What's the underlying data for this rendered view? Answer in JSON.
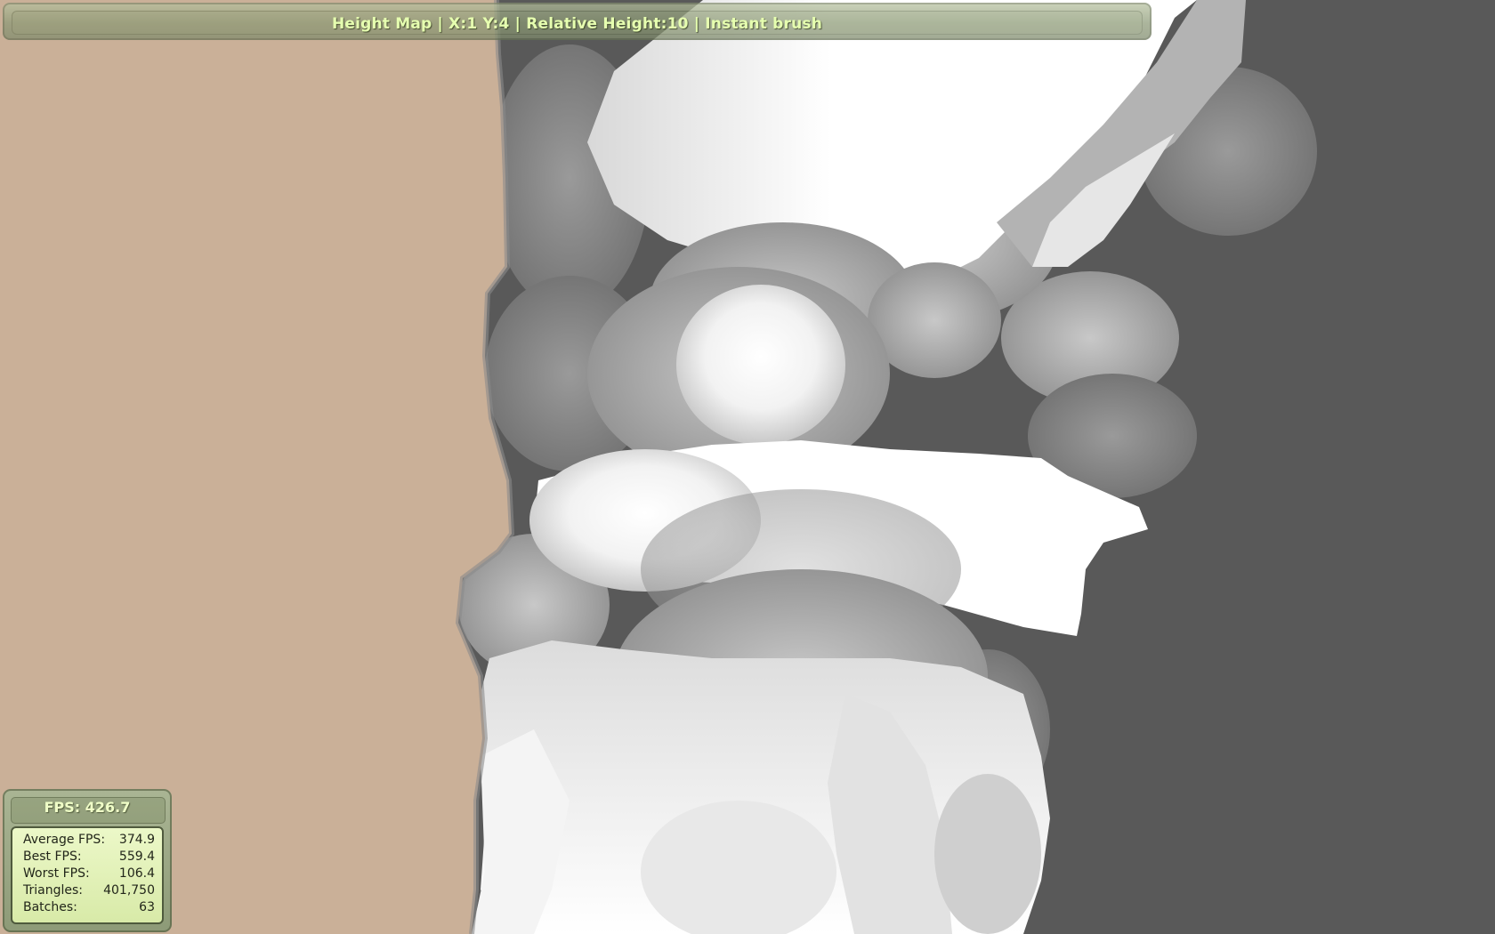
{
  "status_bar": {
    "text": "Height Map | X:1 Y:4 | Relative Height:10 | Instant brush"
  },
  "scene": {
    "left_region_color": "#cab098",
    "background_color": "#595959"
  },
  "fps_panel": {
    "title": "FPS: 426.7",
    "stats": [
      {
        "label": "Average FPS:",
        "value": "374.9"
      },
      {
        "label": "Best FPS:",
        "value": "559.4"
      },
      {
        "label": "Worst FPS:",
        "value": "106.4"
      },
      {
        "label": "Triangles:",
        "value": "401,750"
      },
      {
        "label": "Batches:",
        "value": "63"
      }
    ]
  },
  "colors": {
    "panel_accent": "#e6ffb0",
    "panel_body": "#8d9a77"
  }
}
